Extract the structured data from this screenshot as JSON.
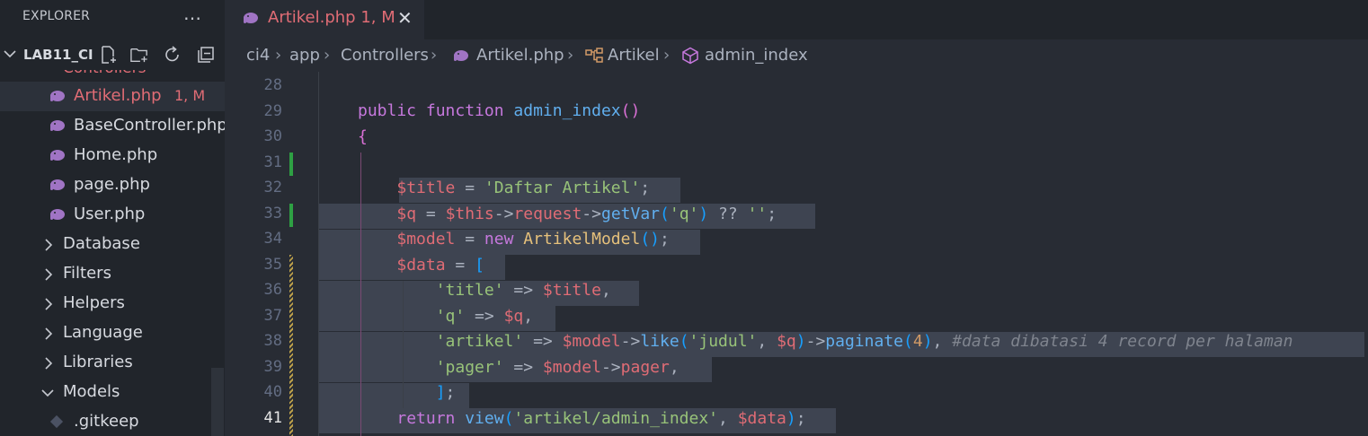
{
  "sidebar": {
    "title": "EXPLORER",
    "more_icon": "…",
    "project": "LAB11_CI",
    "partial_label": "Controllers",
    "files": [
      {
        "label": "Artikel.php",
        "badge": "1, M"
      },
      {
        "label": "BaseController.php"
      },
      {
        "label": "Home.php"
      },
      {
        "label": "page.php"
      },
      {
        "label": "User.php"
      }
    ],
    "folders": [
      {
        "label": "Database",
        "chevron": "›"
      },
      {
        "label": "Filters",
        "chevron": "›"
      },
      {
        "label": "Helpers",
        "chevron": "›"
      },
      {
        "label": "Language",
        "chevron": "›"
      },
      {
        "label": "Libraries",
        "chevron": "›"
      },
      {
        "label": "Models",
        "chevron": "⌄"
      }
    ],
    "gitkeep": ".gitkeep"
  },
  "tab": {
    "label": "Artikel.php 1, M",
    "close": "✕"
  },
  "breadcrumb": {
    "items": [
      "ci4",
      "app",
      "Controllers",
      "Artikel.php",
      "Artikel",
      "admin_index"
    ],
    "sep": "›"
  },
  "editor": {
    "line_numbers": [
      "28",
      "29",
      "30",
      "31",
      "32",
      "33",
      "34",
      "35",
      "36",
      "37",
      "38",
      "39",
      "40",
      "41"
    ],
    "active_line": "41"
  },
  "colors": {
    "keyword": "#c678dd",
    "function": "#61afef",
    "variable": "#e06c75",
    "string": "#98c379",
    "number": "#d19a66",
    "class": "#e5c07b",
    "comment": "#7f848e",
    "added": "#2ea043",
    "modified": "#bb9f4a"
  }
}
